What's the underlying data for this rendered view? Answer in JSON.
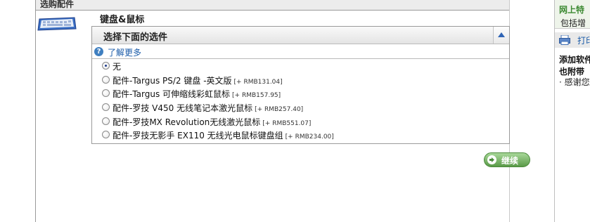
{
  "section": {
    "title": "选购配件"
  },
  "category": {
    "title": "键盘&鼠标",
    "image": "keyboard-icon"
  },
  "panel": {
    "title": "选择下面的选件",
    "collapse_icon": "triangle-up-icon",
    "learn_more": "了解更多",
    "options": [
      {
        "label": "无",
        "price": "",
        "selected": true
      },
      {
        "label": "配件-Targus PS/2 键盘 -英文版",
        "price": "[+ RMB131.04]",
        "selected": false
      },
      {
        "label": "配件-Targus 可伸缩线彩虹鼠标",
        "price": "[+ RMB157.95]",
        "selected": false
      },
      {
        "label": "配件-罗技  V450 无线笔记本激光鼠标",
        "price": "[+ RMB257.40]",
        "selected": false
      },
      {
        "label": "配件-罗技MX Revolution无线激光鼠标",
        "price": "[+ RMB551.07]",
        "selected": false
      },
      {
        "label": "配件-罗技无影手  EX110 无线光电鼠标键盘组",
        "price": "[+ RMB234.00]",
        "selected": false
      }
    ]
  },
  "actions": {
    "continue_label": "继续"
  },
  "sidebar": {
    "heading": "网上特",
    "subheading": "包括增",
    "print_label": "打印",
    "add_title": "添加软件",
    "also_title": "也附带",
    "thanks": "· 感谢您"
  },
  "colors": {
    "link": "#1a5ba8",
    "button_green": "#5a9a48",
    "sidebar_green": "#3c8a32"
  }
}
